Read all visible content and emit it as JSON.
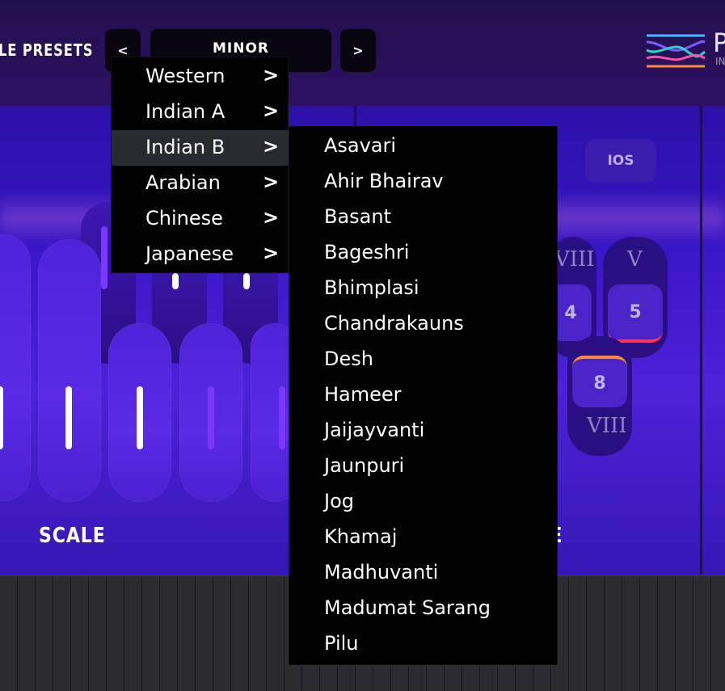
{
  "header": {
    "presets_label": "LE PRESETS",
    "prev_label": "<",
    "next_label": ">",
    "current_preset": "MINOR",
    "logo_letter": "P",
    "logo_sub": "IN"
  },
  "panels": {
    "scale_label": "SCALE",
    "mode_label_partial": "E",
    "ios_button": "IOS",
    "mode_faces": [
      "4",
      "5",
      "8"
    ],
    "roman_numerals": [
      "VIII",
      "V",
      "VIII"
    ]
  },
  "menu": {
    "chevron": ">",
    "items": [
      {
        "label": "Western"
      },
      {
        "label": "Indian A"
      },
      {
        "label": "Indian B",
        "active": true
      },
      {
        "label": "Arabian"
      },
      {
        "label": "Chinese"
      },
      {
        "label": "Japanese"
      }
    ]
  },
  "submenu": {
    "items": [
      "Asavari",
      "Ahir Bhairav",
      "Basant",
      "Bageshri",
      "Bhimplasi",
      "Chandrakauns",
      "Desh",
      "Hameer",
      "Jaijayvanti",
      "Jaunpuri",
      "Jog",
      "Khamaj",
      "Madhuvanti",
      "Madumat Sarang",
      "Pilu"
    ]
  },
  "colors": {
    "panel": "#3a16c7",
    "menu_bg": "#000000",
    "menu_active": "#2a2b30",
    "topbar": "#22104d"
  }
}
